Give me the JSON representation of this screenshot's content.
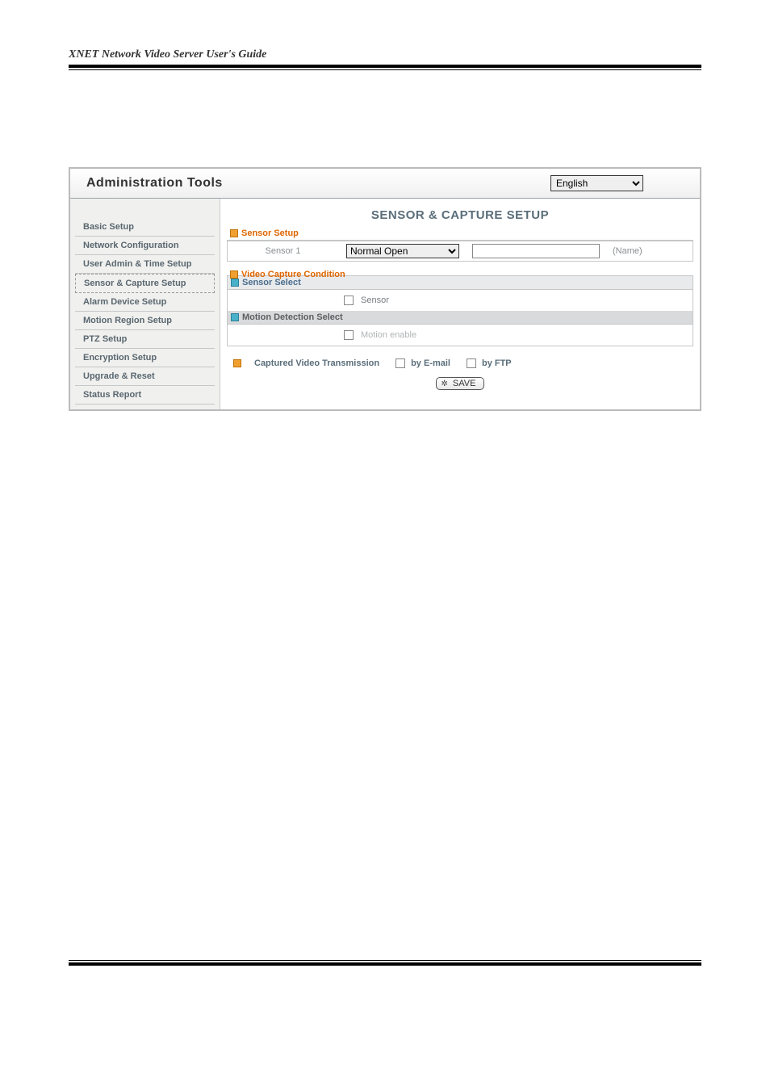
{
  "doc_title": "XNET Network Video Server User's Guide",
  "header": {
    "title": "Administration Tools",
    "language": "English"
  },
  "sidebar": {
    "items": [
      {
        "label": "Basic Setup"
      },
      {
        "label": "Network Configuration"
      },
      {
        "label": "User Admin & Time Setup"
      },
      {
        "label": "Sensor & Capture Setup",
        "active": true
      },
      {
        "label": "Alarm Device Setup"
      },
      {
        "label": "Motion Region Setup"
      },
      {
        "label": "PTZ Setup"
      },
      {
        "label": "Encryption Setup"
      },
      {
        "label": "Upgrade & Reset"
      },
      {
        "label": "Status Report"
      }
    ]
  },
  "content": {
    "title": "SENSOR & CAPTURE SETUP",
    "sensor_setup": {
      "header": "Sensor Setup",
      "sensor_label": "Sensor 1",
      "mode": "Normal Open",
      "name_value": "",
      "name_label": "(Name)"
    },
    "video_capture": {
      "header": "Video Capture Condition",
      "sensor_select_header": "Sensor Select",
      "sensor_check_label": "Sensor",
      "motion_header": "Motion Detection Select",
      "motion_check_label": "Motion enable"
    },
    "transmission": {
      "label": "Captured Video Transmission",
      "email": "by E-mail",
      "ftp": "by FTP"
    },
    "save": "SAVE"
  }
}
